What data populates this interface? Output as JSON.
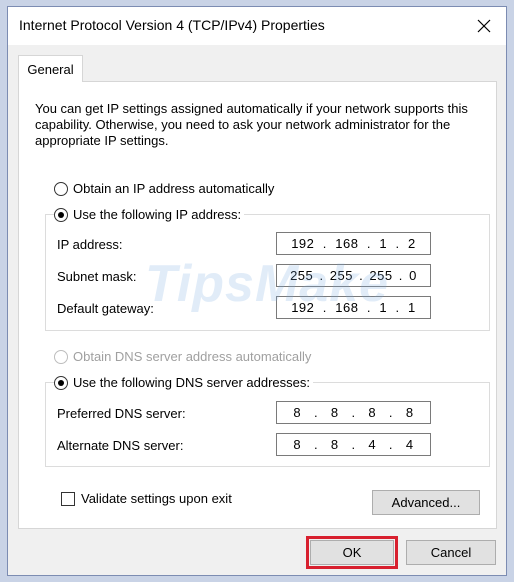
{
  "window": {
    "title": "Internet Protocol Version 4 (TCP/IPv4) Properties"
  },
  "tabs": [
    {
      "label": "General"
    }
  ],
  "intro": "You can get IP settings assigned automatically if your network supports this capability. Otherwise, you need to ask your network administrator for the appropriate IP settings.",
  "ip_mode": {
    "auto_label": "Obtain an IP address automatically",
    "manual_label": "Use the following IP address:",
    "selected": "manual"
  },
  "ip_fields": {
    "ip": {
      "label": "IP address:",
      "octets": [
        "192",
        "168",
        "1",
        "2"
      ]
    },
    "mask": {
      "label": "Subnet mask:",
      "octets": [
        "255",
        "255",
        "255",
        "0"
      ]
    },
    "gateway": {
      "label": "Default gateway:",
      "octets": [
        "192",
        "168",
        "1",
        "1"
      ]
    }
  },
  "dns_mode": {
    "auto_label": "Obtain DNS server address automatically",
    "auto_disabled": true,
    "manual_label": "Use the following DNS server addresses:",
    "selected": "manual"
  },
  "dns_fields": {
    "preferred": {
      "label": "Preferred DNS server:",
      "octets": [
        "8",
        "8",
        "8",
        "8"
      ]
    },
    "alternate": {
      "label": "Alternate DNS server:",
      "octets": [
        "8",
        "8",
        "4",
        "4"
      ]
    }
  },
  "validate": {
    "label": "Validate settings upon exit",
    "checked": false
  },
  "buttons": {
    "advanced": "Advanced...",
    "ok": "OK",
    "cancel": "Cancel"
  },
  "watermark": "TipsMake",
  "colors": {
    "highlight": "#d8202f",
    "frame": "#c9d3e6"
  },
  "icons": {
    "close": "close-icon"
  }
}
